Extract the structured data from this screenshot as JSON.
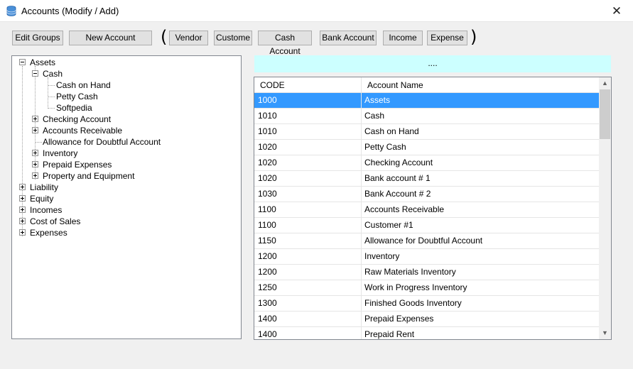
{
  "window": {
    "title": "Accounts (Modify / Add)",
    "close_label": "✕",
    "app_icon": "database-icon"
  },
  "toolbar": {
    "edit_groups": "Edit Groups",
    "new_account": "New Account",
    "open_paren": "(",
    "close_paren": ")",
    "filters": [
      "Vendor",
      "Custome",
      "Cash Account",
      "Bank Account",
      "Income",
      "Expense"
    ]
  },
  "tree": {
    "assets": "Assets",
    "cash": "Cash",
    "cash_on_hand": "Cash on Hand",
    "petty_cash": "Petty Cash",
    "softpedia": "Softpedia",
    "checking": "Checking Account",
    "receivable": "Accounts Receivable",
    "allowance": "Allowance for Doubtful Account",
    "inventory": "Inventory",
    "prepaid": "Prepaid Expenses",
    "property": "Property and Equipment",
    "liability": "Liability",
    "equity": "Equity",
    "incomes": "Incomes",
    "cost_of_sales": "Cost of Sales",
    "expenses": "Expenses"
  },
  "info_bar": "....",
  "grid": {
    "columns": [
      "CODE",
      "Account Name"
    ],
    "rows": [
      [
        "1000",
        "Assets"
      ],
      [
        "1010",
        "Cash"
      ],
      [
        "1010",
        "Cash on Hand"
      ],
      [
        "1020",
        "Petty Cash"
      ],
      [
        "1020",
        "Checking Account"
      ],
      [
        "1020",
        "Bank account # 1"
      ],
      [
        "1030",
        "Bank Account # 2"
      ],
      [
        "1100",
        "Accounts Receivable"
      ],
      [
        "1100",
        "Customer #1"
      ],
      [
        "1150",
        "Allowance for Doubtful Account"
      ],
      [
        "1200",
        "Inventory"
      ],
      [
        "1200",
        "Raw Materials Inventory"
      ],
      [
        "1250",
        "Work in Progress Inventory"
      ],
      [
        "1300",
        "Finished Goods Inventory"
      ],
      [
        "1400",
        "Prepaid Expenses"
      ],
      [
        "1400",
        "Prepaid Rent"
      ]
    ],
    "selected_row": 0,
    "scroll_up": "▲",
    "scroll_down": "▼"
  },
  "colors": {
    "selection": "#3399ff",
    "info_bar": "#ccffff"
  }
}
